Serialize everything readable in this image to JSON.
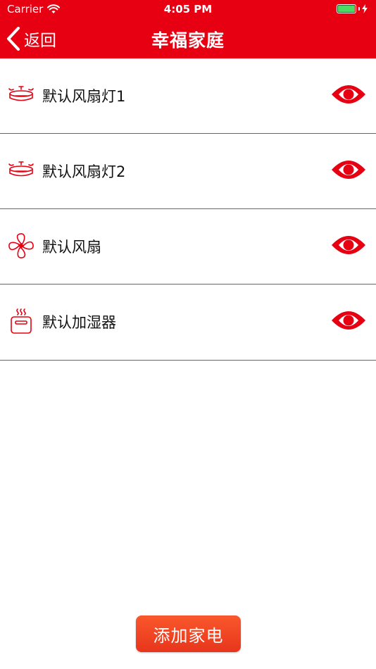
{
  "status_bar": {
    "carrier": "Carrier",
    "time": "4:05 PM",
    "battery_color": "#4cd964"
  },
  "nav": {
    "back_label": "返回",
    "title": "幸福家庭",
    "back_icon": "chevron-left-icon",
    "background": "#e60012"
  },
  "devices": [
    {
      "name": "默认风扇灯1",
      "icon": "ceiling-fan-light-icon",
      "action_icon": "eye-icon"
    },
    {
      "name": "默认风扇灯2",
      "icon": "ceiling-fan-light-icon",
      "action_icon": "eye-icon"
    },
    {
      "name": "默认风扇",
      "icon": "fan-icon",
      "action_icon": "eye-icon"
    },
    {
      "name": "默认加湿器",
      "icon": "humidifier-icon",
      "action_icon": "eye-icon"
    }
  ],
  "add_button": {
    "label": "添加家电",
    "color": "#f04a24"
  }
}
